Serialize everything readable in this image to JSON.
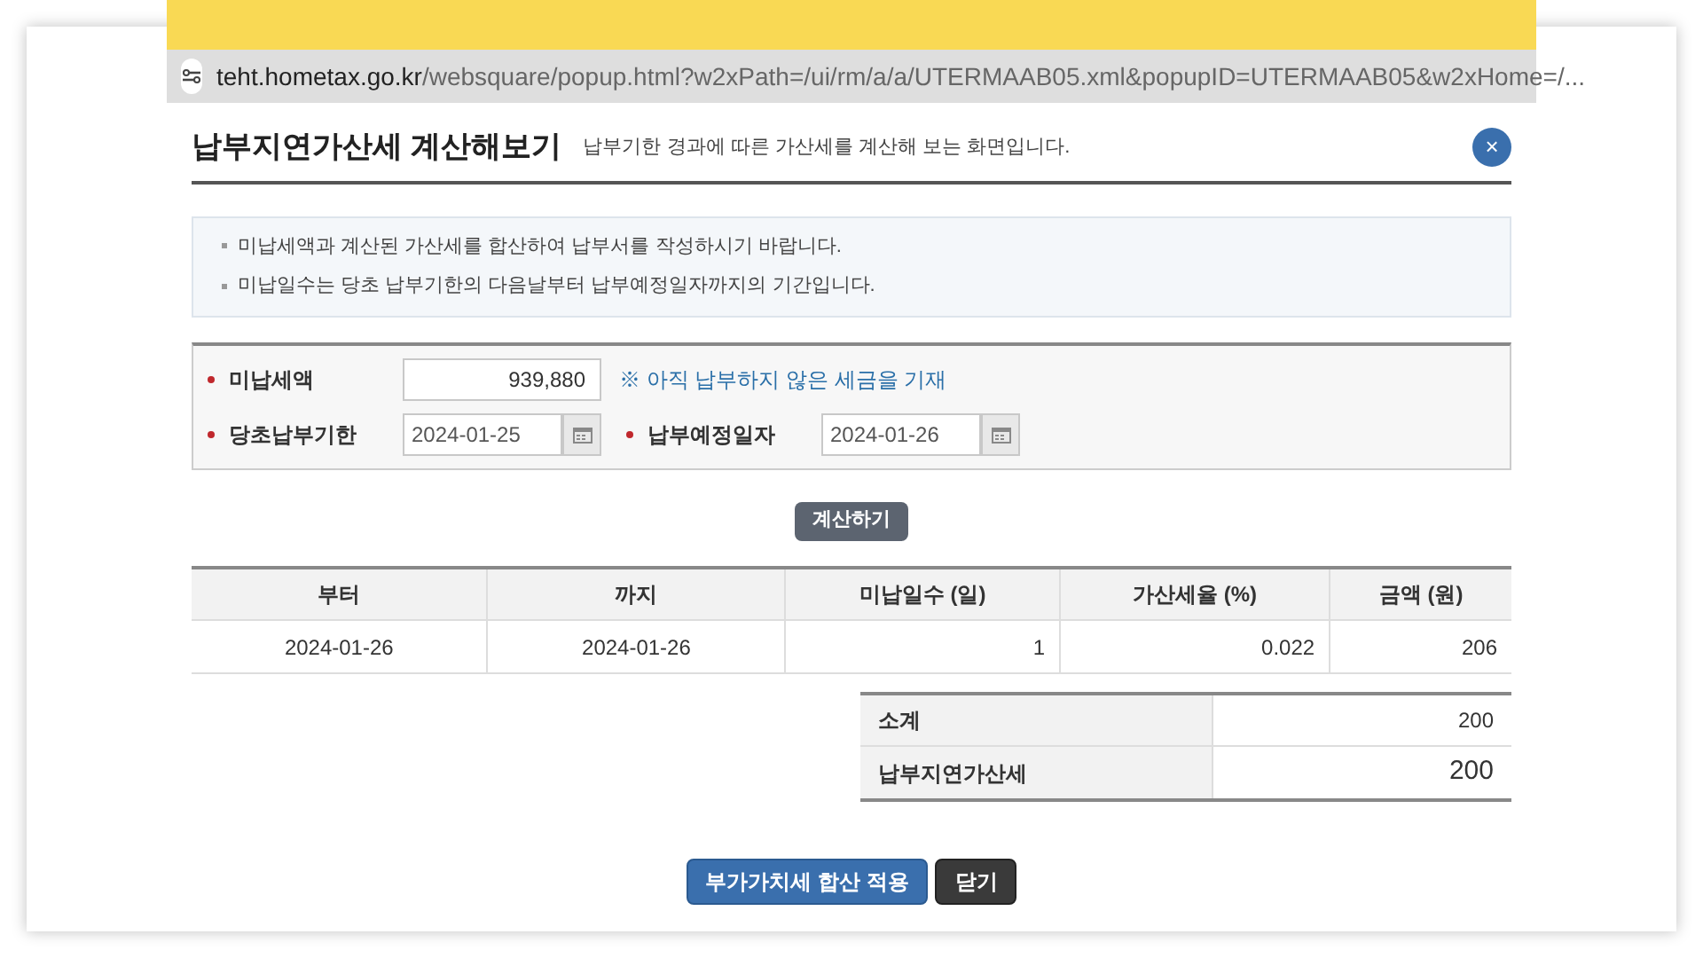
{
  "browser": {
    "url_host": "teht.hometax.go.kr",
    "url_path": "/websquare/popup.html?w2xPath=/ui/rm/a/a/UTERMAAB05.xml&popupID=UTERMAAB05&w2xHome=/..."
  },
  "popup": {
    "title": "납부지연가산세 계산해보기",
    "subtitle": "납부기한 경과에 따른 가산세를 계산해 보는 화면입니다.",
    "close": "×"
  },
  "notes": [
    "미납세액과 계산된 가산세를 합산하여 납부서를 작성하시기 바랍니다.",
    "미납일수는 당초 납부기한의 다음날부터 납부예정일자까지의 기간입니다."
  ],
  "form": {
    "unpaid_label": "미납세액",
    "unpaid_value": "939,880",
    "unpaid_hint": "※ 아직 납부하지 않은 세금을 기재",
    "due_label": "당초납부기한",
    "due_value": "2024-01-25",
    "pay_label": "납부예정일자",
    "pay_value": "2024-01-26"
  },
  "calculate_button": "계산하기",
  "table": {
    "columns": [
      "부터",
      "까지",
      "미납일수 (일)",
      "가산세율 (%)",
      "금액 (원)"
    ],
    "rows": [
      [
        "2024-01-26",
        "2024-01-26",
        "1",
        "0.022",
        "206"
      ]
    ]
  },
  "summary": [
    {
      "label": "소계",
      "value": "200",
      "kind": "subtotal"
    },
    {
      "label": "납부지연가산세",
      "value": "200",
      "kind": "total"
    }
  ],
  "buttons": [
    {
      "label": "부가가치세 합산 적용",
      "kind": "primary"
    },
    {
      "label": "닫기",
      "kind": "dark"
    }
  ]
}
